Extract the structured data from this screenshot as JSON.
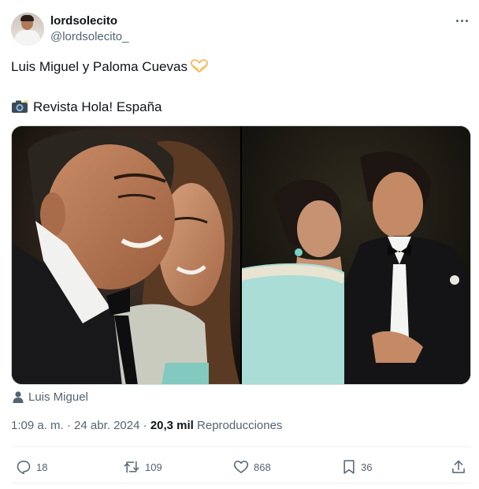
{
  "author": {
    "display_name": "lordsolecito",
    "handle": "@lordsolecito_"
  },
  "tweet": {
    "line1": "Luis Miguel y Paloma Cuevas",
    "line1_emoji": "heart-hands-emoji",
    "line2_emoji": "camera-flash-emoji",
    "line2": "Revista Hola! España"
  },
  "media": {
    "photos": [
      {
        "description_icon": "photo-couple-closeup"
      },
      {
        "description_icon": "photo-couple-formal"
      }
    ]
  },
  "tagged_user": "Luis Miguel",
  "meta": {
    "time": "1:09 a. m.",
    "separator": "·",
    "date": "24 abr. 2024",
    "views_count": "20,3 mil",
    "views_label": "Reproducciones"
  },
  "actions": {
    "replies": "18",
    "retweets": "109",
    "likes": "868",
    "bookmarks": "36"
  },
  "colors": {
    "text_primary": "#0f1419",
    "text_secondary": "#536471",
    "border": "#cfd9de",
    "divider": "#eff3f4"
  }
}
